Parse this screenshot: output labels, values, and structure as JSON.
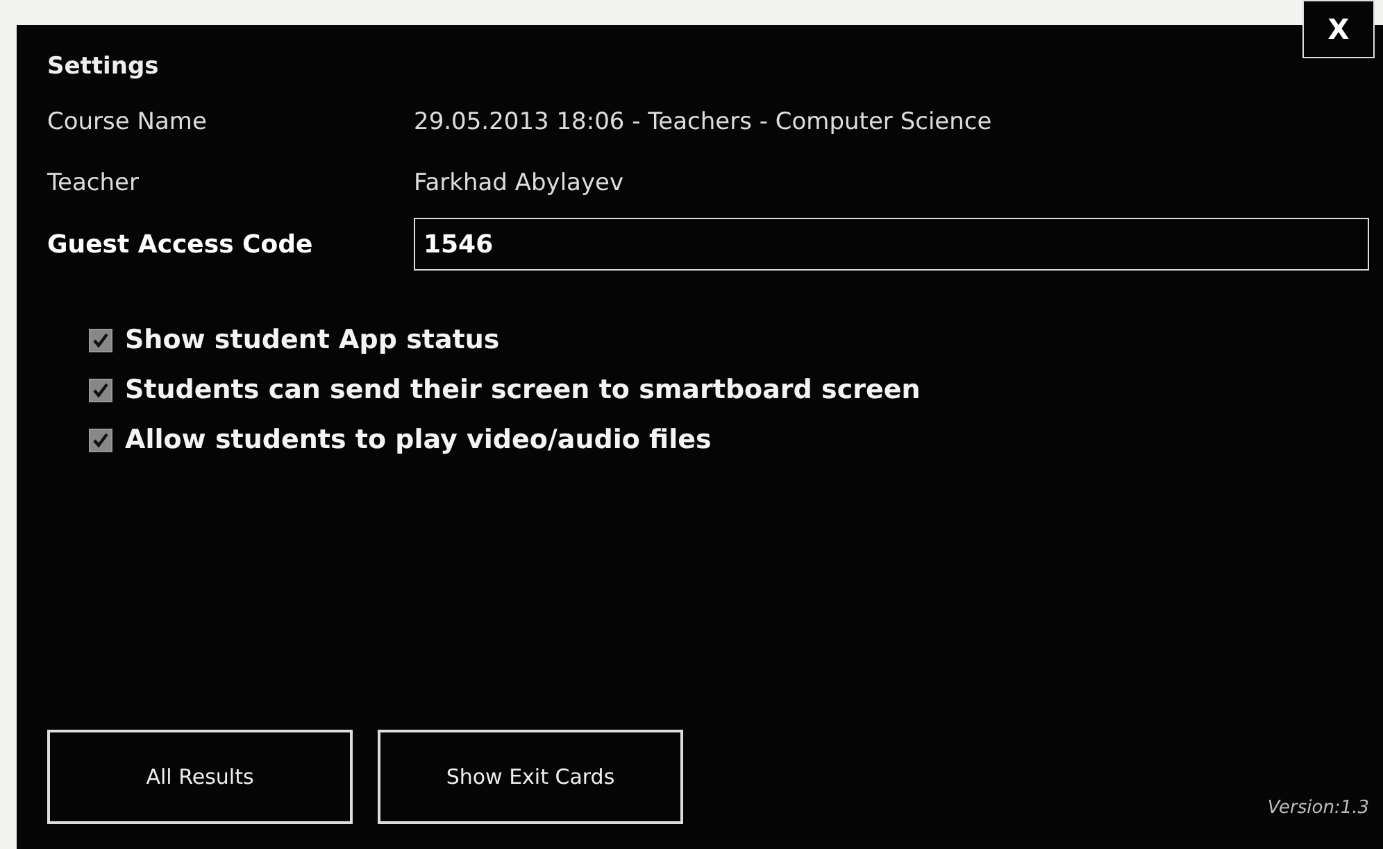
{
  "window": {
    "title": "Settings",
    "close": "X"
  },
  "fields": [
    {
      "label": "Course Name",
      "value": "29.05.2013 18:06 - Teachers - Computer Science",
      "kind": "text"
    },
    {
      "label": "Teacher",
      "value": "Farkhad Abylayev",
      "kind": "text"
    },
    {
      "label": "Guest Access Code",
      "value": "1546",
      "kind": "input"
    }
  ],
  "options": [
    {
      "label": "Show student App status",
      "checked": true
    },
    {
      "label": "Students can send their screen to smartboard screen",
      "checked": true
    },
    {
      "label": "Allow students to play video/audio files",
      "checked": true
    }
  ],
  "buttons": [
    "All Results",
    "Show Exit Cards"
  ],
  "version": "Version:1.3"
}
